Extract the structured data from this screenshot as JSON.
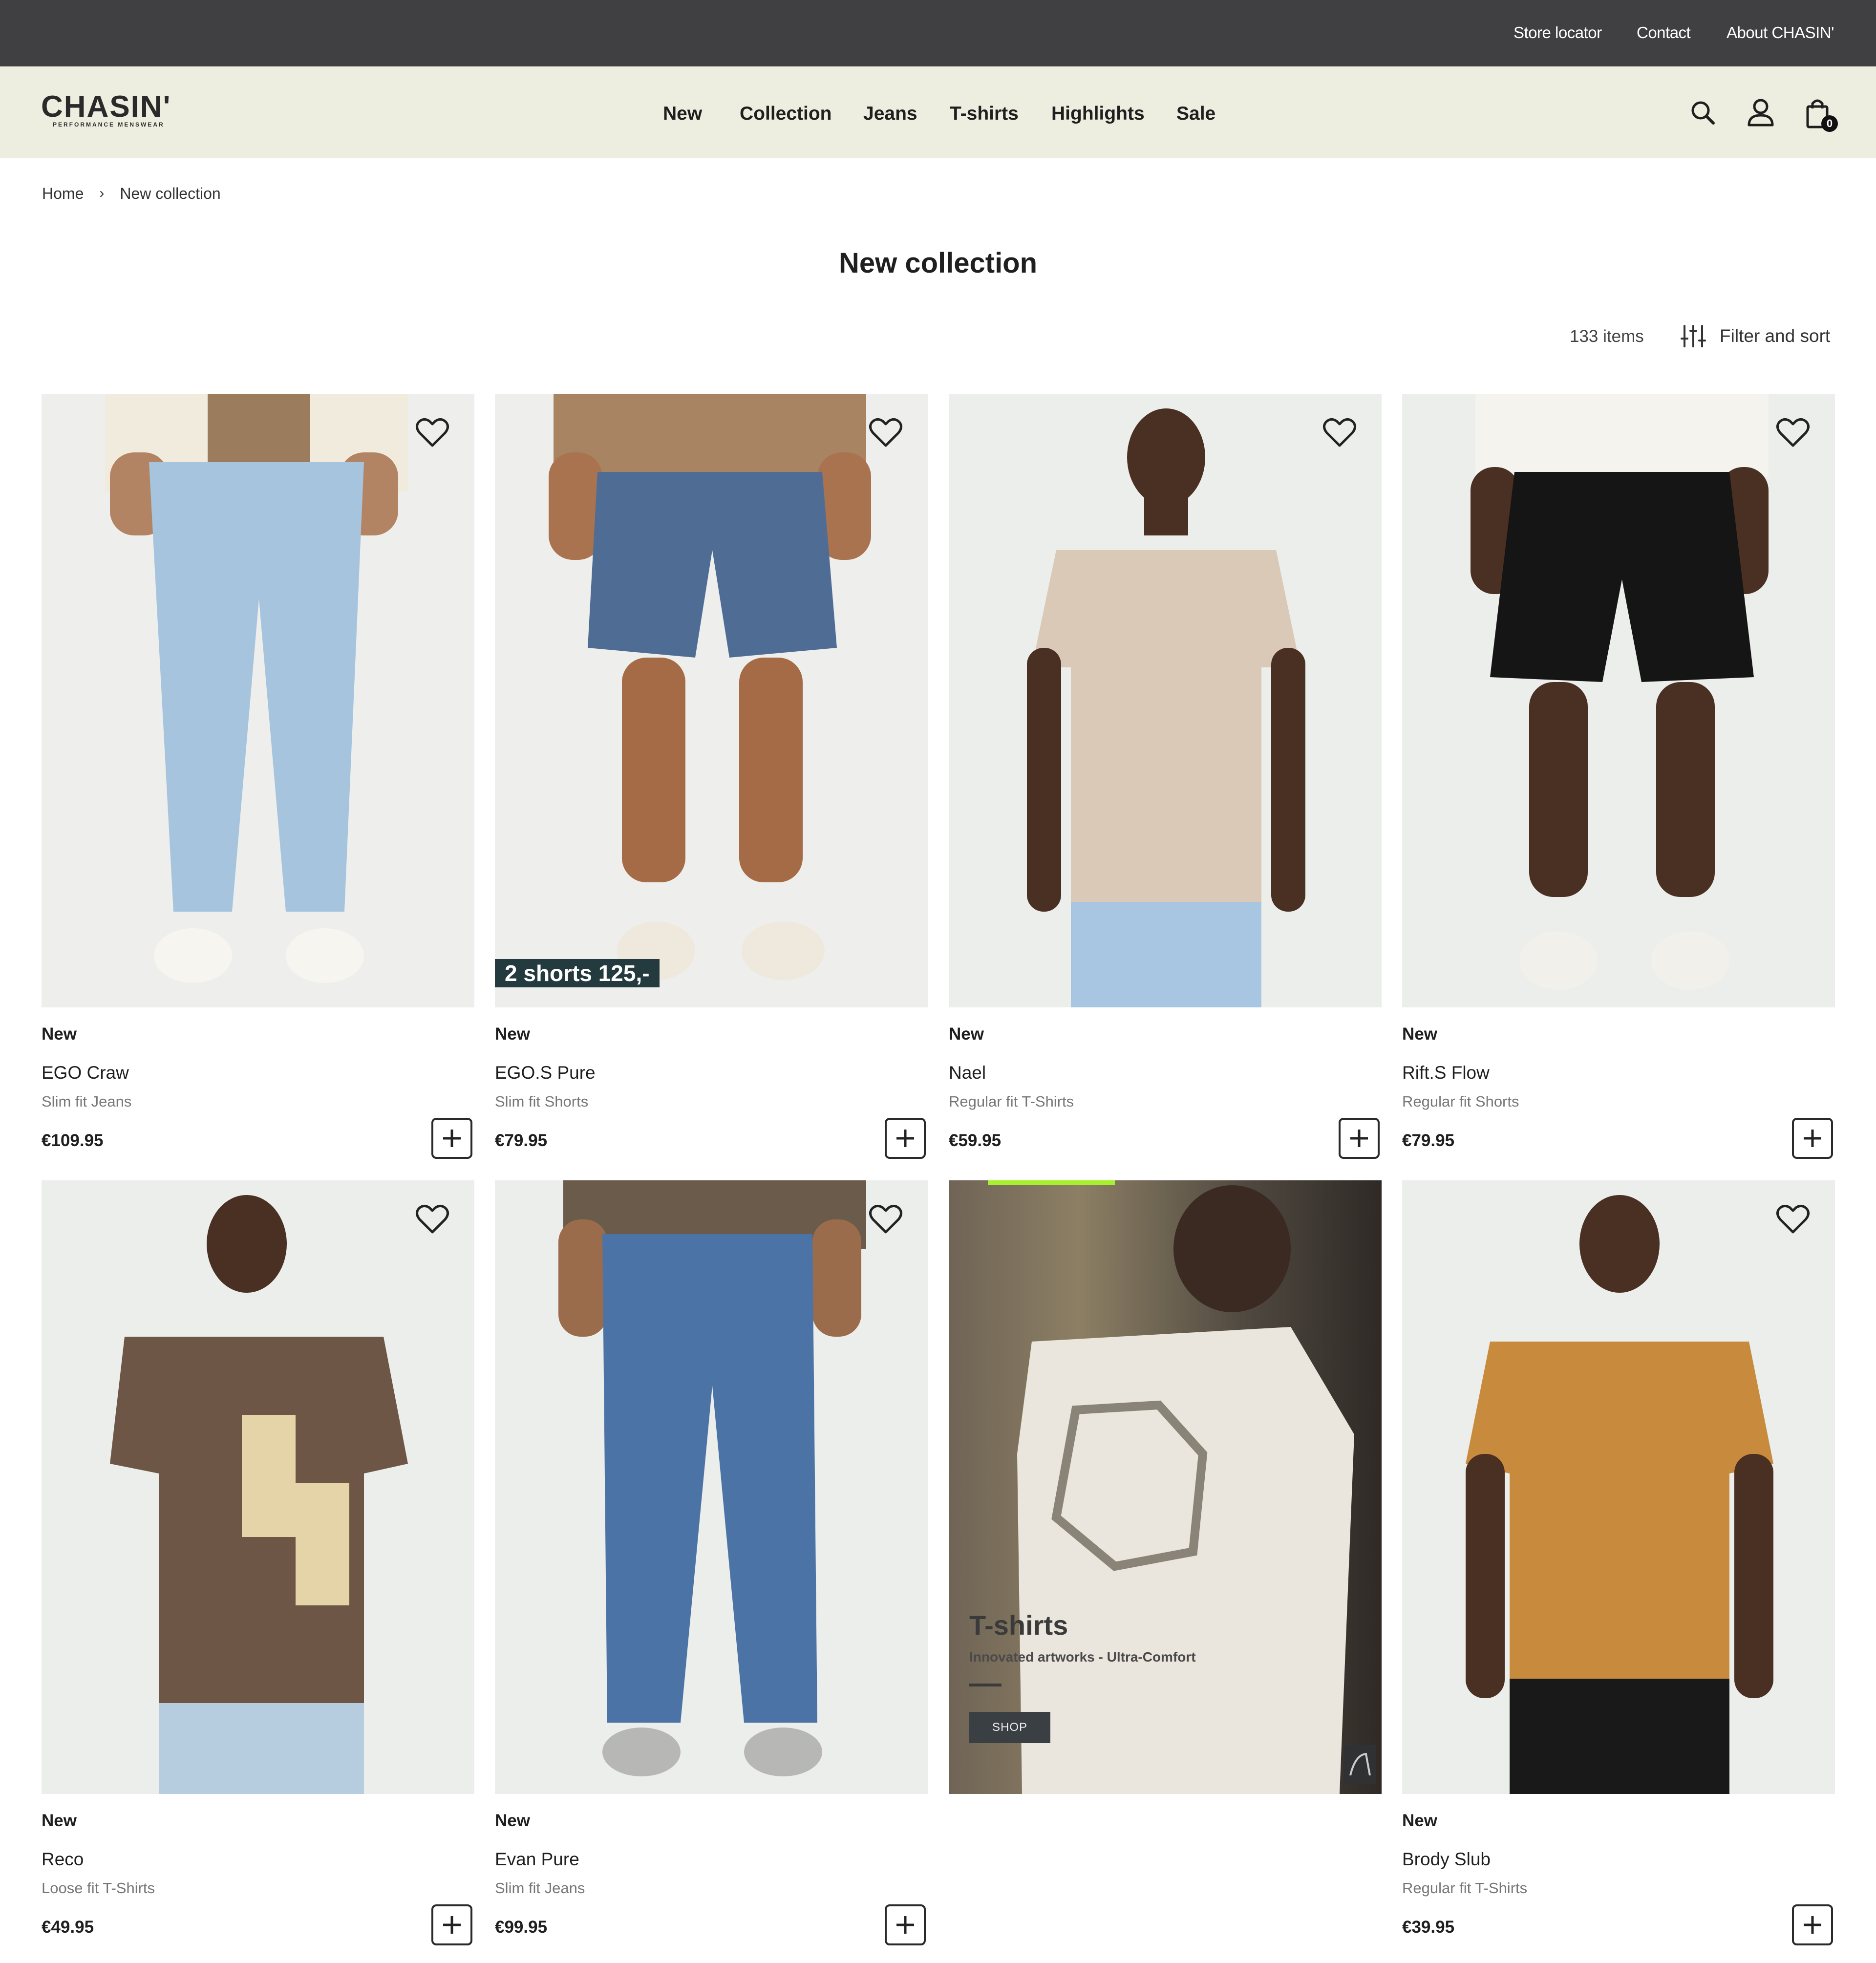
{
  "topbar": {
    "links": [
      "Store locator",
      "Contact",
      "About CHASIN'"
    ]
  },
  "header": {
    "logo": "CHASIN'",
    "logo_sub": "PERFORMANCE MENSWEAR",
    "nav": [
      "New",
      "Collection",
      "Jeans",
      "T-shirts",
      "Highlights",
      "Sale"
    ],
    "cart_count": "0",
    "icons": [
      "search-icon",
      "user-icon",
      "shopping-bag-icon"
    ]
  },
  "breadcrumb": {
    "home": "Home",
    "separator": "›",
    "current": "New collection"
  },
  "page": {
    "title": "New collection",
    "items_count": "133 items",
    "filter_label": "Filter and sort"
  },
  "products": [
    {
      "badge": "New",
      "name": "EGO Craw",
      "fit": "Slim fit Jeans",
      "price": "€109.95"
    },
    {
      "badge": "New",
      "name": "EGO.S Pure",
      "fit": "Slim fit Shorts",
      "price": "€79.95",
      "promo": "2 shorts 125,-"
    },
    {
      "badge": "New",
      "name": "Nael",
      "fit": "Regular fit T-Shirts",
      "price": "€59.95"
    },
    {
      "badge": "New",
      "name": "Rift.S Flow",
      "fit": "Regular fit Shorts",
      "price": "€79.95"
    },
    {
      "badge": "New",
      "name": "Reco",
      "fit": "Loose fit T-Shirts",
      "price": "€49.95"
    },
    {
      "badge": "New",
      "name": "Evan Pure",
      "fit": "Slim fit Jeans",
      "price": "€99.95"
    },
    {
      "badge": "New",
      "name": "Brody Slub",
      "fit": "Regular fit T-Shirts",
      "price": "€39.95"
    }
  ],
  "banner": {
    "title": "T-shirts",
    "subtitle": "Innovated artworks - Ultra-Comfort",
    "button": "SHOP"
  }
}
